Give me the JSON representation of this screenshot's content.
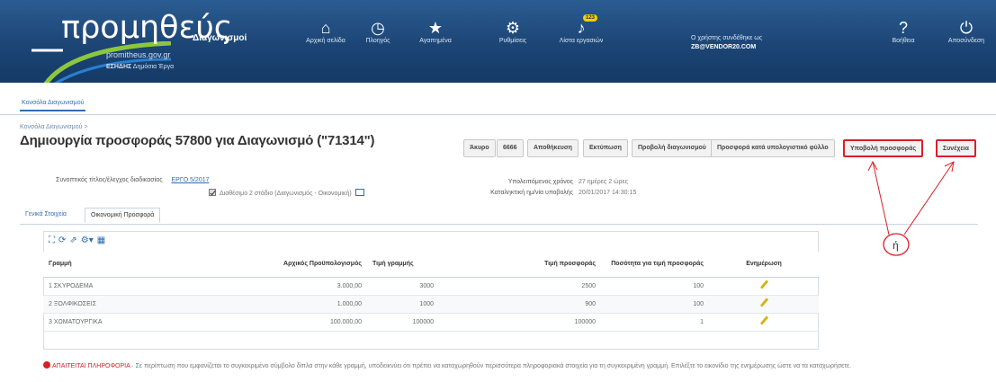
{
  "header": {
    "logo_word": "προμηθεύς",
    "logo_sub": "Διαγωνισμοί",
    "logo_url": "promitheus.gov.gr",
    "logo_tag_bold": "ΕΣΗΔΗΣ",
    "logo_tag": "Δημόσια Έργα",
    "nav": [
      {
        "label": "Αρχική σελίδα",
        "icon": "home-icon"
      },
      {
        "label": "Πλοηγός",
        "icon": "clock-icon"
      },
      {
        "label": "Αγαπημένα",
        "icon": "star-icon"
      },
      {
        "label": "Ρυθμίσεις",
        "icon": "gear-icon"
      },
      {
        "label": "Λίστα εργασιών",
        "icon": "bell-icon",
        "badge": "123"
      },
      {
        "label": "Βοήθεια",
        "icon": "help-icon"
      },
      {
        "label": "Αποσύνδεση",
        "icon": "power-icon"
      }
    ],
    "user_line1": "Ο χρήστης συνδέθηκε ως",
    "user_line2": "ZB@VENDOR20.COM",
    "colors": {
      "bar": "#1c4575",
      "sweep_green": "#8cc63f",
      "sweep_blue": "#2a7fd0"
    }
  },
  "tab": {
    "label": "Κονσόλα Διαγωνισμού"
  },
  "breadcrumb": "Κονσόλα Διαγωνισμού >",
  "page_title": "Δημιουργία προσφοράς 57800 για Διαγωνισμό (\"71314\")",
  "actions": {
    "back": "Άκυρο",
    "save": "Αποθήκευση",
    "print": "Εκτύπωση",
    "view_tender": "Προβολή διαγωνισμού",
    "offer_by_spreadsheet": "Προσφορά κατά υπολογιστικό φύλλο",
    "submit_offer": "Υποβολή προσφοράς",
    "continue": "Συνέχεια",
    "extra": "6666"
  },
  "info": {
    "contract_label": "Συνοπτικός τίτλος/έλεγχος διαδικασίας",
    "contract_link": "ΕΡΓΟ 5/2017",
    "checkbox_text": "Διαθέσιμο 2 στάδιο (Διαγωνισμός - Οικονομική)",
    "remaining_label": "Υπολειπόμενος χρόνος",
    "remaining_value": "27 ημέρες 2 ώρες",
    "closing_label": "Καταληκτική ημ/νία υποβολής",
    "closing_value": "20/01/2017 14:30:15"
  },
  "subtabs": {
    "general": "Γενικά Στοιχεία",
    "financial": "Οικονομική Προσφορά"
  },
  "table": {
    "headers": [
      "Γραμμή",
      "Αρχικός Προϋπολογισμός",
      "Τιμή γραμμής",
      "Τιμή προσφοράς",
      "Ποσότητα για τιμή προσφοράς",
      "Ενημέρωση"
    ],
    "rows": [
      {
        "line": "1 ΣΚΥΡΟΔΕΜΑ",
        "budget": "3.000,00",
        "line_price": "3000",
        "offer": "2500",
        "qty": "100"
      },
      {
        "line": "2 ΞΟΛΦΙΚΟΣΕΙΣ",
        "budget": "1.000,00",
        "line_price": "1000",
        "offer": "900",
        "qty": "100"
      },
      {
        "line": "3 ΧΩΜΑΤΟΥΡΓΙΚΑ",
        "budget": "100.000,00",
        "line_price": "100000",
        "offer": "100000",
        "qty": "1"
      }
    ]
  },
  "note": {
    "prefix": "ΑΠΑΙΤΕΙΤΑΙ ΠΛΗΡΟΦΟΡΙΑ",
    "text": "· Σε περίπτωση που εμφανίζεται το συγκεκριμένο σύμβολο δίπλα στην κάθε γραμμή, υποδεικνύει ότι πρέπει να καταχωρηθούν περισσότερα πληροφοριακά στοιχεία για τη συγκεκριμένη γραμμή. Επιλέξτε το εικονίδιο της ενημέρωσης ώστε να τα καταχωρήσετε."
  },
  "annotation": {
    "label": "ή",
    "color": "#d92026"
  }
}
